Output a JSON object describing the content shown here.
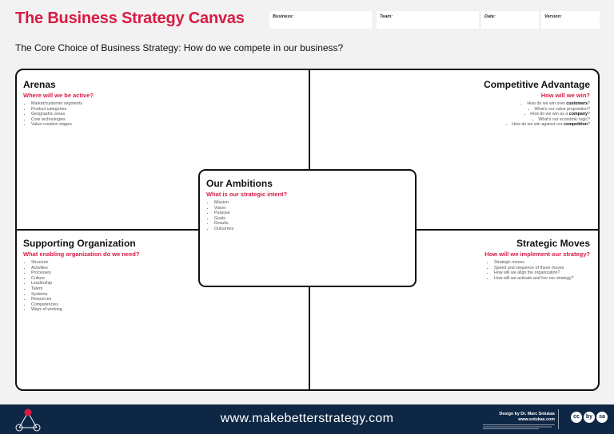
{
  "header": {
    "title": "The Business Strategy Canvas",
    "fields": [
      {
        "label": "Business:"
      },
      {
        "label": "Team:"
      },
      {
        "label": "Date:"
      },
      {
        "label": "Version:"
      }
    ],
    "subtitle": "The Core Choice of Business Strategy: How do we compete in our business?"
  },
  "quadrants": {
    "arenas": {
      "title": "Arenas",
      "question": "Where will we be active?",
      "items": [
        "Market/customer segments",
        "Product categories",
        "Geographic areas",
        "Core technologies",
        "Value-creation stages"
      ]
    },
    "competitive_advantage": {
      "title": "Competitive Advantage",
      "question": "How will we win?",
      "items": [
        {
          "pre": "How do we win over ",
          "em": "customers",
          "post": "?"
        },
        {
          "pre": "What's our value proposition?",
          "em": "",
          "post": ""
        },
        {
          "pre": "How do we win as a ",
          "em": "company",
          "post": "?"
        },
        {
          "pre": "What's our economic logic?",
          "em": "",
          "post": ""
        },
        {
          "pre": "How do we win against our ",
          "em": "competition",
          "post": "?"
        }
      ]
    },
    "supporting_organization": {
      "title": "Supporting Organization",
      "question": "What enabling organization do we need?",
      "items": [
        "Structure",
        "Activities",
        "Processes",
        "Culture",
        "Leadership",
        "Talent",
        "Systems",
        "Resources",
        "Competencies",
        "Ways of working"
      ]
    },
    "strategic_moves": {
      "title": "Strategic Moves",
      "question": "How will we implement our strategy?",
      "items": [
        "Strategic moves",
        "Speed and sequence of these moves",
        "How will we align the organization?",
        "How will we activate and live our strategy?"
      ]
    }
  },
  "center": {
    "title": "Our Ambitions",
    "question": "What is our strategic intent?",
    "items": [
      "Mission",
      "Vision",
      "Purpose",
      "Goals",
      "Results",
      "Outcomes"
    ]
  },
  "footer": {
    "url": "www.makebetterstrategy.com",
    "credit_line1": "Design by Dr. Marc Sniukas",
    "credit_line2": "www.sniukas.com",
    "license_icons": [
      "cc",
      "by",
      "sa"
    ]
  },
  "colors": {
    "accent": "#d81b44",
    "footer_bg": "#0e2745"
  }
}
